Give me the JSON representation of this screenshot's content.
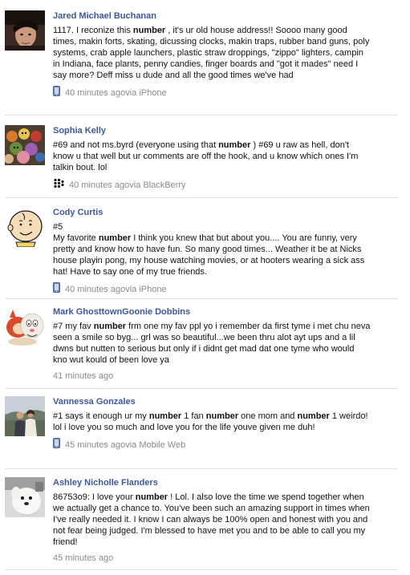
{
  "posts": [
    {
      "name": "Jared Michael Buchanan",
      "avatar_icon": "person-photo-icon",
      "parts": [
        {
          "t": "1117. I reconize this  "
        },
        {
          "t": "number",
          "b": true
        },
        {
          "t": " , it's ur old house address!! Soooo many good times, makin forts, skating, dicussing clocks, makin traps, rubber band guns, poly systems, crab apple launchers, plastic straw droppings, \"zippo\" lighters, campin in Indiana, face plants, penny candies, finger boards and \"got it mades\" need I say more? Deff miss u dude and all the good times we've had"
        }
      ],
      "time": "40 minutes ago",
      "via": " via iPhone",
      "device_icon": "phone-icon"
    },
    {
      "name": "Sophia Kelly",
      "avatar_icon": "muppets-photo-icon",
      "parts": [
        {
          "t": "#69 and not ms.byrd (everyone using that  "
        },
        {
          "t": "number",
          "b": true
        },
        {
          "t": " ) #69 u raw as hell, don't know u that well but ur comments are off the hook, and u know which ones I'm talkin bout. lol"
        }
      ],
      "time": "40 minutes ago",
      "via": " via BlackBerry",
      "device_icon": "blackberry-icon"
    },
    {
      "name": "Cody Curtis",
      "avatar_icon": "charlie-brown-icon",
      "parts": [
        {
          "t": "#5"
        },
        {
          "br": true
        },
        {
          "t": "My favorite  "
        },
        {
          "t": "number",
          "b": true
        },
        {
          "t": "  I think you knew that but about you.... You are funny, very pretty and know how to have fun. So many good times... Weather it be at Nicks house playin pong, my house watching movies, or at hooters wearing a sick ass hat! Have to say one of my true friends."
        }
      ],
      "time": "40 minutes ago",
      "via": " via iPhone",
      "device_icon": "phone-icon"
    },
    {
      "name": "Mark GhosttownGoonie Dobbins",
      "avatar_icon": "cartoon-dog-cat-icon",
      "parts": [
        {
          "t": "#7 my fav  "
        },
        {
          "t": "number",
          "b": true
        },
        {
          "t": "  frm one my fav ppl yo i remember da first tyme i met chu neva seen a smile so byg... grl was so beautiful...we been thru alot ayt ups and a lil dwns but nutten to serious but only if i didnt get mad dat one tyme who would kno wut kould of been love ya"
        }
      ],
      "time": "41 minutes ago",
      "via": "",
      "device_icon": ""
    },
    {
      "name": "Vannessa Gonzales",
      "avatar_icon": "couple-photo-icon",
      "parts": [
        {
          "t": "#1 says it enough ur my  "
        },
        {
          "t": "number",
          "b": true
        },
        {
          "t": "  1 fan  "
        },
        {
          "t": "number",
          "b": true
        },
        {
          "t": "  one mom and  "
        },
        {
          "t": "number",
          "b": true
        },
        {
          "t": " 1 weirdo! lol i love you so much and love you for the life youve given me duh!"
        }
      ],
      "time": "45 minutes ago",
      "via": " via Mobile Web",
      "device_icon": "phone-icon"
    },
    {
      "name": "Ashley Nicholle Flanders",
      "avatar_icon": "seal-plush-icon",
      "parts": [
        {
          "t": "86753o9: I love your  "
        },
        {
          "t": "number",
          "b": true
        },
        {
          "t": " ! Lol. I also love the time we spend together when we actually get a chance to. You've been such an amazing support in times when I've really needed it. I know I can always be 100% open and honest with you and not fear being judged. I'm blessed to have met you and to be able to call you my friend!"
        }
      ],
      "time": "45 minutes ago",
      "via": "",
      "device_icon": ""
    }
  ]
}
